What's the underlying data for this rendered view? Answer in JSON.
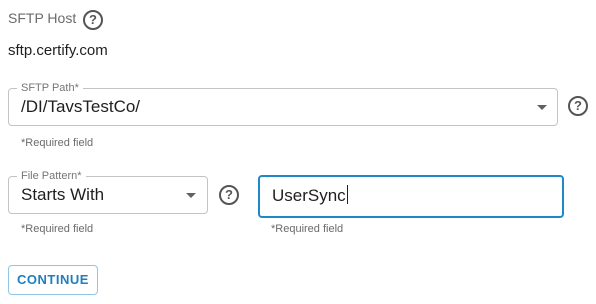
{
  "sftp_host": {
    "label": "SFTP Host",
    "help_icon": "help-circle-icon",
    "value": "sftp.certify.com"
  },
  "sftp_path": {
    "label": "SFTP Path*",
    "value": "/DI/TavsTestCo/",
    "required_text": "*Required field",
    "help_icon": "help-circle-icon"
  },
  "file_pattern": {
    "label": "File Pattern*",
    "value": "Starts With",
    "required_text": "*Required field",
    "help_icon": "help-circle-icon"
  },
  "pattern_text": {
    "value": "UserSync",
    "required_text": "*Required field"
  },
  "actions": {
    "continue_label": "CONTINUE"
  },
  "colors": {
    "accent": "#1e88c9",
    "border": "#c4c4c4"
  }
}
